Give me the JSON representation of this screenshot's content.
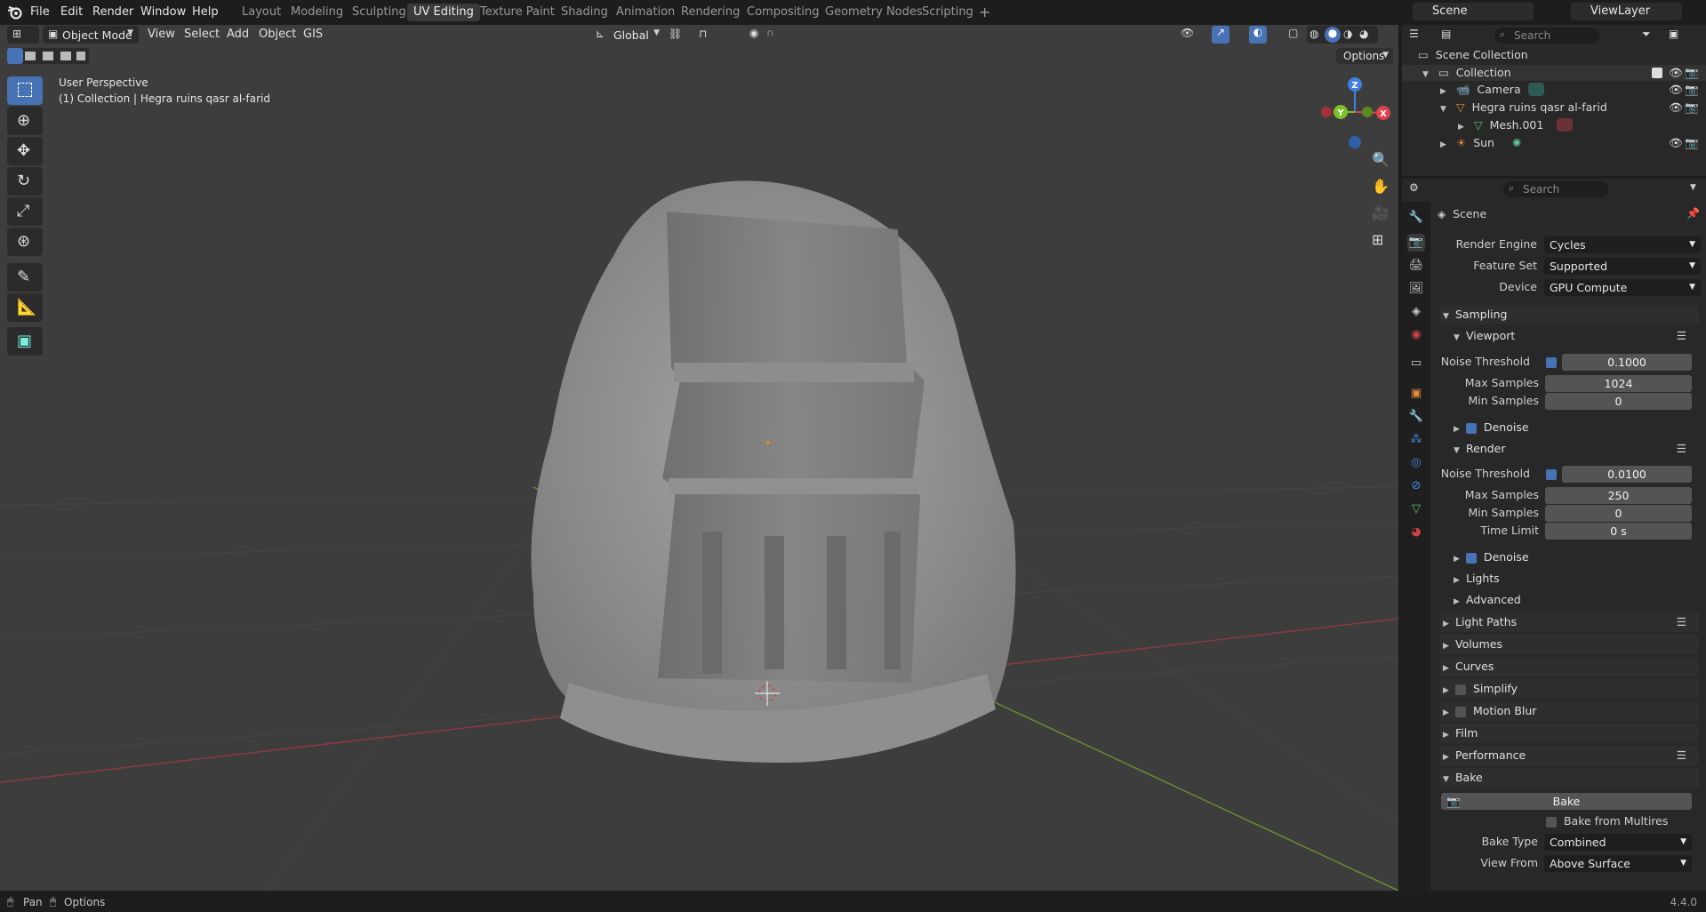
{
  "topbar": {
    "menus": [
      "File",
      "Edit",
      "Render",
      "Window",
      "Help"
    ],
    "workspaces": [
      "Layout",
      "Modeling",
      "Sculpting",
      "UV Editing",
      "Texture Paint",
      "Shading",
      "Animation",
      "Rendering",
      "Compositing",
      "Geometry Nodes",
      "Scripting"
    ],
    "active_workspace": "UV Editing",
    "scene": "Scene",
    "view_layer": "ViewLayer"
  },
  "viewport": {
    "mode": "Object Mode",
    "menus": [
      "View",
      "Select",
      "Add",
      "Object",
      "GIS"
    ],
    "orientation": "Global",
    "options_label": "Options",
    "info_line1": "User Perspective",
    "info_line2": "(1) Collection | Hegra ruins qasr al-farid",
    "gizmo_labels": {
      "x": "X",
      "y": "Y",
      "z": "Z"
    }
  },
  "outliner": {
    "search_placeholder": "Search",
    "root": "Scene Collection",
    "collection": "Collection",
    "items": [
      {
        "label": "Camera"
      },
      {
        "label": "Hegra ruins qasr al-farid"
      },
      {
        "label": "Mesh.001"
      },
      {
        "label": "Sun"
      }
    ]
  },
  "properties": {
    "search_placeholder": "Search",
    "context": "Scene",
    "render_engine_label": "Render Engine",
    "render_engine": "Cycles",
    "feature_set_label": "Feature Set",
    "feature_set": "Supported",
    "device_label": "Device",
    "device": "GPU Compute",
    "sampling": "Sampling",
    "viewport": "Viewport",
    "noise_threshold_label": "Noise Threshold",
    "viewport_noise_threshold": "0.1000",
    "max_samples_label": "Max Samples",
    "viewport_max_samples": "1024",
    "min_samples_label": "Min Samples",
    "viewport_min_samples": "0",
    "denoise": "Denoise",
    "render": "Render",
    "render_noise_threshold": "0.0100",
    "render_max_samples": "250",
    "render_min_samples": "0",
    "time_limit_label": "Time Limit",
    "time_limit": "0 s",
    "lights": "Lights",
    "advanced": "Advanced",
    "light_paths": "Light Paths",
    "volumes": "Volumes",
    "curves": "Curves",
    "simplify": "Simplify",
    "motion_blur": "Motion Blur",
    "film": "Film",
    "performance": "Performance",
    "bake_section": "Bake",
    "bake_button": "Bake",
    "bake_from_multires": "Bake from Multires",
    "bake_type_label": "Bake Type",
    "bake_type": "Combined",
    "view_from_label": "View From",
    "view_from": "Above Surface"
  },
  "statusbar": {
    "pan": "Pan",
    "options": "Options",
    "version": "4.4.0"
  },
  "colors": {
    "accent": "#4772b3",
    "axis_x": "#e0404a",
    "axis_y": "#7fbf2a",
    "axis_z": "#3f7fdf"
  }
}
